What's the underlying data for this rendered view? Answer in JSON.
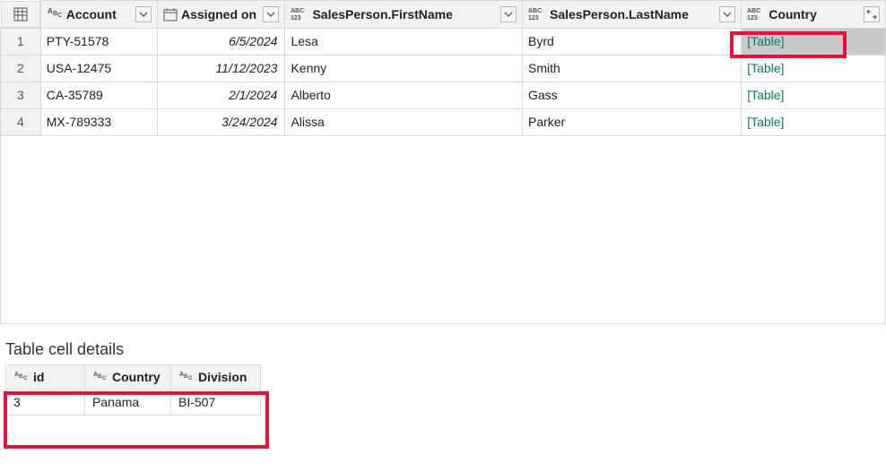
{
  "main": {
    "columns": {
      "account": "Account",
      "assigned": "Assigned on",
      "first": "SalesPerson.FirstName",
      "last": "SalesPerson.LastName",
      "country": "Country"
    },
    "rows": [
      {
        "num": "1",
        "account": "PTY-51578",
        "assigned": "6/5/2024",
        "first": "Lesa",
        "last": "Byrd",
        "country": "[Table]"
      },
      {
        "num": "2",
        "account": "USA-12475",
        "assigned": "11/12/2023",
        "first": "Kenny",
        "last": "Smith",
        "country": "[Table]"
      },
      {
        "num": "3",
        "account": "CA-35789",
        "assigned": "2/1/2024",
        "first": "Alberto",
        "last": "Gass",
        "country": "[Table]"
      },
      {
        "num": "4",
        "account": "MX-789333",
        "assigned": "3/24/2024",
        "first": "Alissa",
        "last": "Parker",
        "country": "[Table]"
      }
    ]
  },
  "details": {
    "title": "Table cell details",
    "columns": {
      "id": "id",
      "country": "Country",
      "division": "Division"
    },
    "row": {
      "id": "3",
      "country": "Panama",
      "division": "BI-507"
    }
  }
}
